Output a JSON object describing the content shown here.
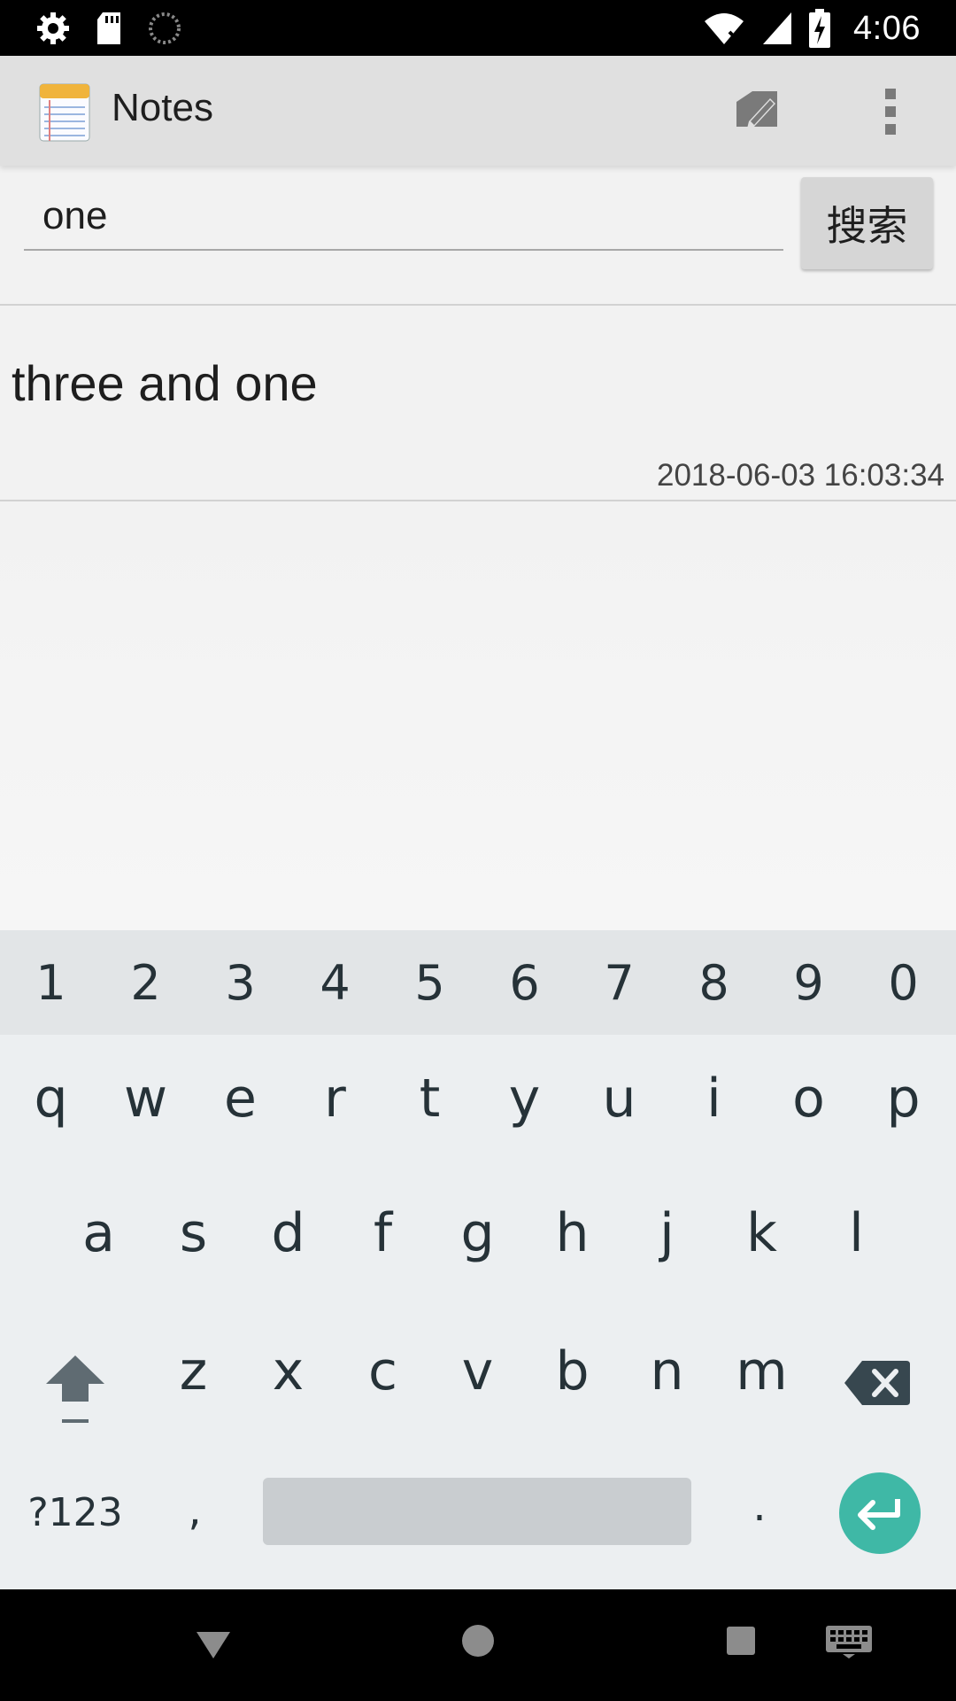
{
  "status_bar": {
    "time": "4:06",
    "icons": [
      "settings-icon",
      "sd-card-icon",
      "sync-icon",
      "wifi-off-icon",
      "signal-icon",
      "battery-charging-icon"
    ]
  },
  "app_bar": {
    "title": "Notes",
    "icons": [
      "notepad-icon",
      "compose-icon",
      "overflow-menu-icon"
    ]
  },
  "search": {
    "value": "one",
    "button_label": "搜索"
  },
  "notes": [
    {
      "title": "three and one",
      "date": "2018-06-03 16:03:34"
    }
  ],
  "keyboard": {
    "number_row": [
      "1",
      "2",
      "3",
      "4",
      "5",
      "6",
      "7",
      "8",
      "9",
      "0"
    ],
    "row1": [
      "q",
      "w",
      "e",
      "r",
      "t",
      "y",
      "u",
      "i",
      "o",
      "p"
    ],
    "row2": [
      "a",
      "s",
      "d",
      "f",
      "g",
      "h",
      "j",
      "k",
      "l"
    ],
    "row3": [
      "z",
      "x",
      "c",
      "v",
      "b",
      "n",
      "m"
    ],
    "symbols_label": "?123",
    "comma": ",",
    "period": ".",
    "accent_color": "#3fb8a6"
  },
  "nav_bar": {
    "icons": [
      "back-icon",
      "home-icon",
      "recents-icon",
      "keyboard-switch-icon"
    ]
  }
}
